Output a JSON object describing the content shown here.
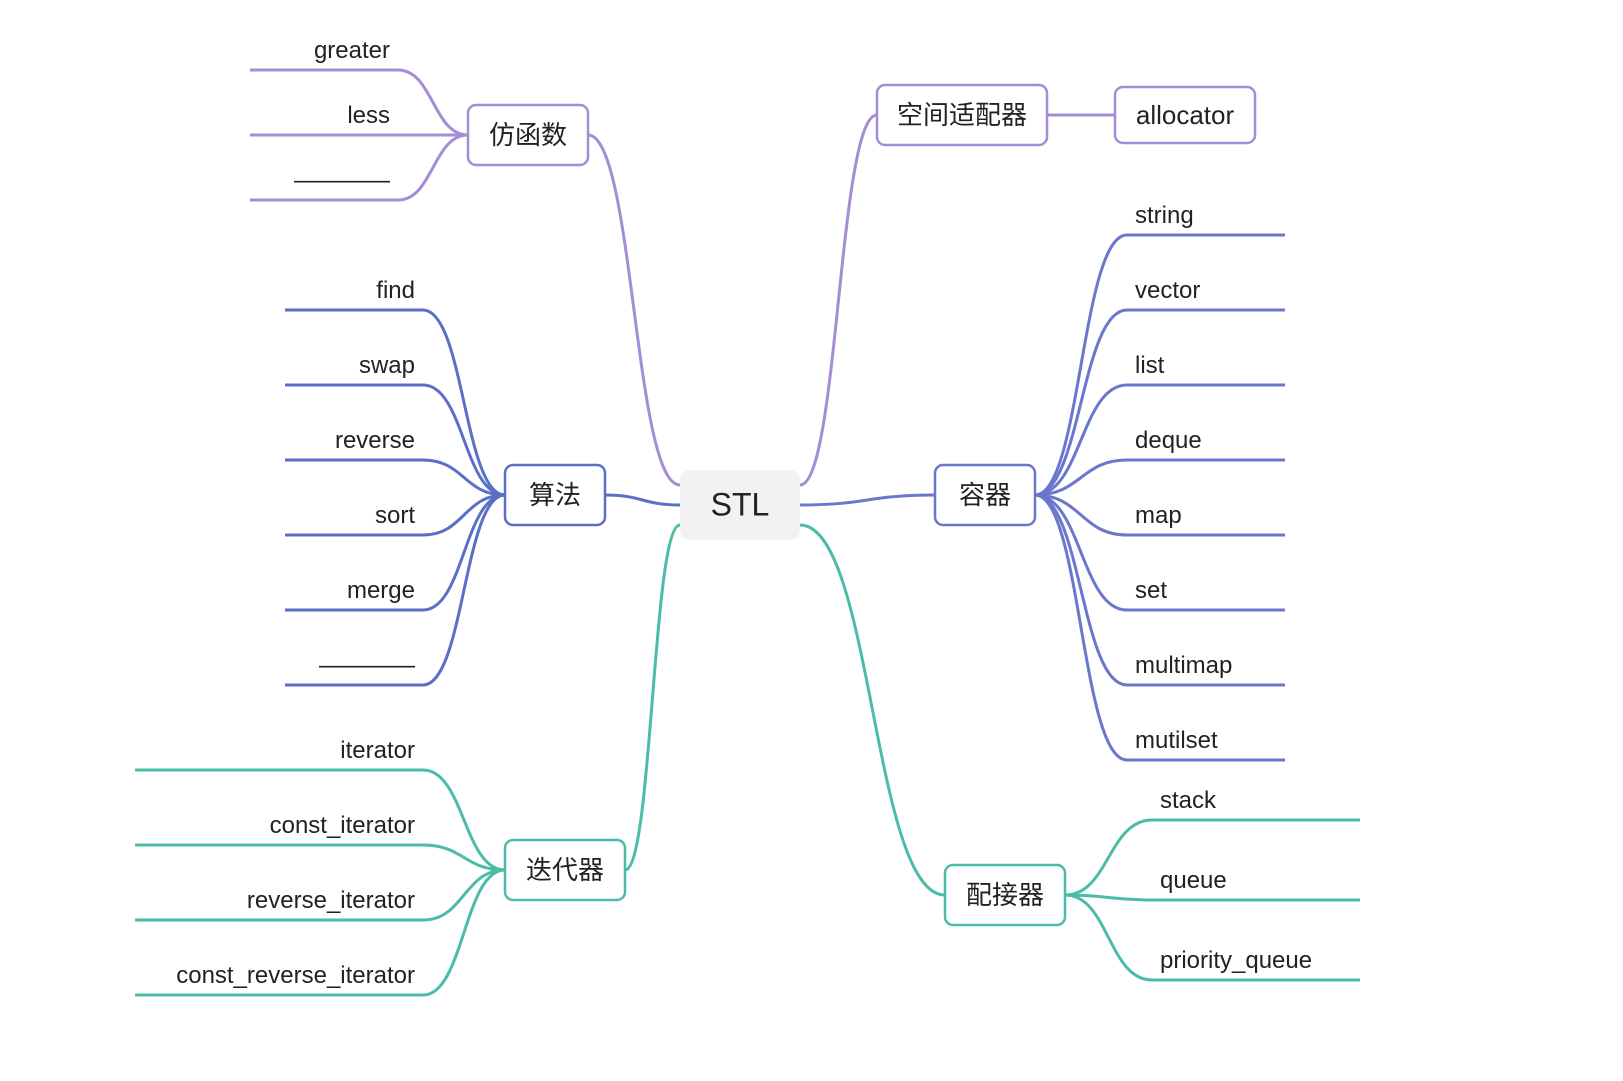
{
  "root": {
    "label": "STL"
  },
  "branches": {
    "functor": {
      "label": "仿函数",
      "color": "#A58CD6",
      "leaves": [
        "greater",
        "less",
        "————"
      ]
    },
    "alloc": {
      "label": "空间适配器",
      "color": "#A58CD6",
      "leaves": [
        "allocator"
      ]
    },
    "algo": {
      "label": "算法",
      "color": "#5B6FC7",
      "leaves": [
        "find",
        "swap",
        "reverse",
        "sort",
        "merge",
        "————"
      ]
    },
    "cont": {
      "label": "容器",
      "color": "#6A77CC",
      "leaves": [
        "string",
        "vector",
        "list",
        "deque",
        "map",
        "set",
        "multimap",
        "mutilset"
      ]
    },
    "iter": {
      "label": "迭代器",
      "color": "#4DBBAA",
      "leaves": [
        "iterator",
        "const_iterator",
        "reverse_iterator",
        "const_reverse_iterator"
      ]
    },
    "adapt": {
      "label": "配接器",
      "color": "#4DBBAA",
      "leaves": [
        "stack",
        "queue",
        "priority_queue"
      ]
    }
  }
}
